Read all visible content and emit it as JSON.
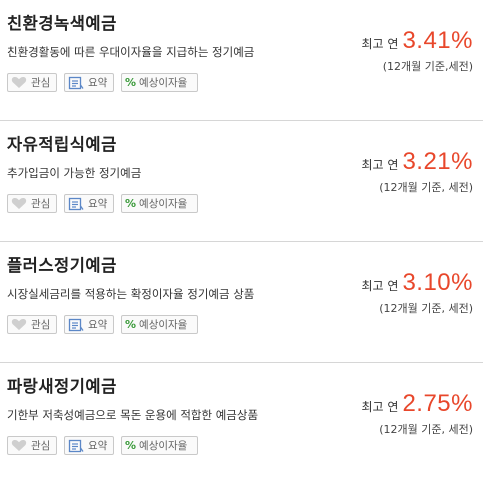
{
  "products": [
    {
      "title": "친환경녹색예금",
      "description": "친환경활동에 따른 우대이자율을 지급하는 정기예금",
      "rate_prefix": "최고 연",
      "rate": "3.41%",
      "rate_note": "(12개월 기준,세전)"
    },
    {
      "title": "자유적립식예금",
      "description": "추가입금이 가능한 정기예금",
      "rate_prefix": "최고 연",
      "rate": "3.21%",
      "rate_note": "(12개월 기준, 세전)"
    },
    {
      "title": "플러스정기예금",
      "description": "시장실세금리를 적용하는 확정이자율 정기예금 상품",
      "rate_prefix": "최고 연",
      "rate": "3.10%",
      "rate_note": "(12개월 기준, 세전)"
    },
    {
      "title": "파랑새정기예금",
      "description": "기한부 저축성예금으로 목돈 운용에 적합한 예금상품",
      "rate_prefix": "최고 연",
      "rate": "2.75%",
      "rate_note": "(12개월 기준, 세전)"
    }
  ],
  "buttons": {
    "favorite_label": "관심",
    "summary_label": "요약",
    "calc_label": "예상이자율",
    "calc_symbol": "%"
  },
  "colors": {
    "rate": "#e8472b",
    "percent_icon": "#3a9a3a",
    "divider": "#d6d6d6"
  },
  "icons": [
    "heart-icon",
    "document-icon",
    "percent-icon"
  ]
}
